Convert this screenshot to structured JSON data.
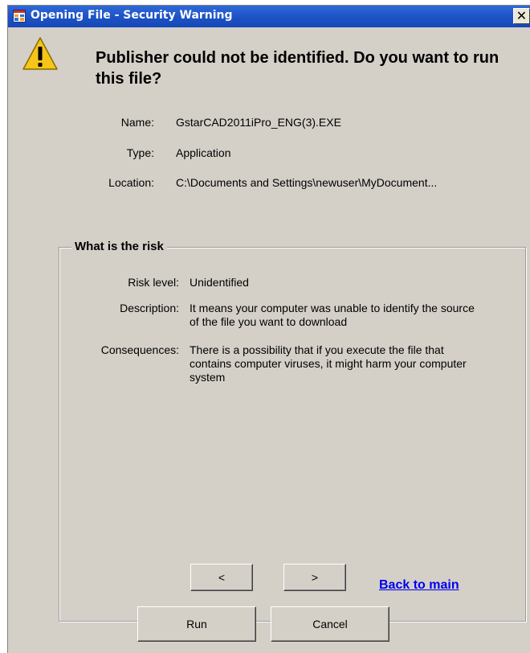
{
  "window": {
    "title": "Opening File - Security Warning",
    "close_glyph": "✕"
  },
  "heading": "Publisher could not be identified. Do you want to run this file?",
  "file_info": {
    "name_label": "Name:",
    "name_value": "GstarCAD2011iPro_ENG(3).EXE",
    "type_label": "Type:",
    "type_value": "Application",
    "location_label": "Location:",
    "location_value": "C:\\Documents and Settings\\newuser\\MyDocument..."
  },
  "risk": {
    "group_title": "What is the risk",
    "level_label": "Risk level:",
    "level_value": "Unidentified",
    "description_label": "Description:",
    "description_value": "It means your computer was unable to identify the source of the file you want to download",
    "consequences_label": "Consequences:",
    "consequences_value": "There is a possibility that if you execute the file that contains computer viruses, it might harm your computer system"
  },
  "navigation": {
    "prev_label": "<",
    "next_label": ">",
    "back_link": "Back to main"
  },
  "actions": {
    "run_label": "Run",
    "cancel_label": "Cancel"
  },
  "colors": {
    "titlebar": "#1f55c8",
    "dialog_bg": "#d4d0c8",
    "link": "#0000ee",
    "warning_icon": "#f5c518"
  },
  "icons": {
    "title_icon": "app-window-icon",
    "warning_icon": "warning-triangle-icon"
  }
}
